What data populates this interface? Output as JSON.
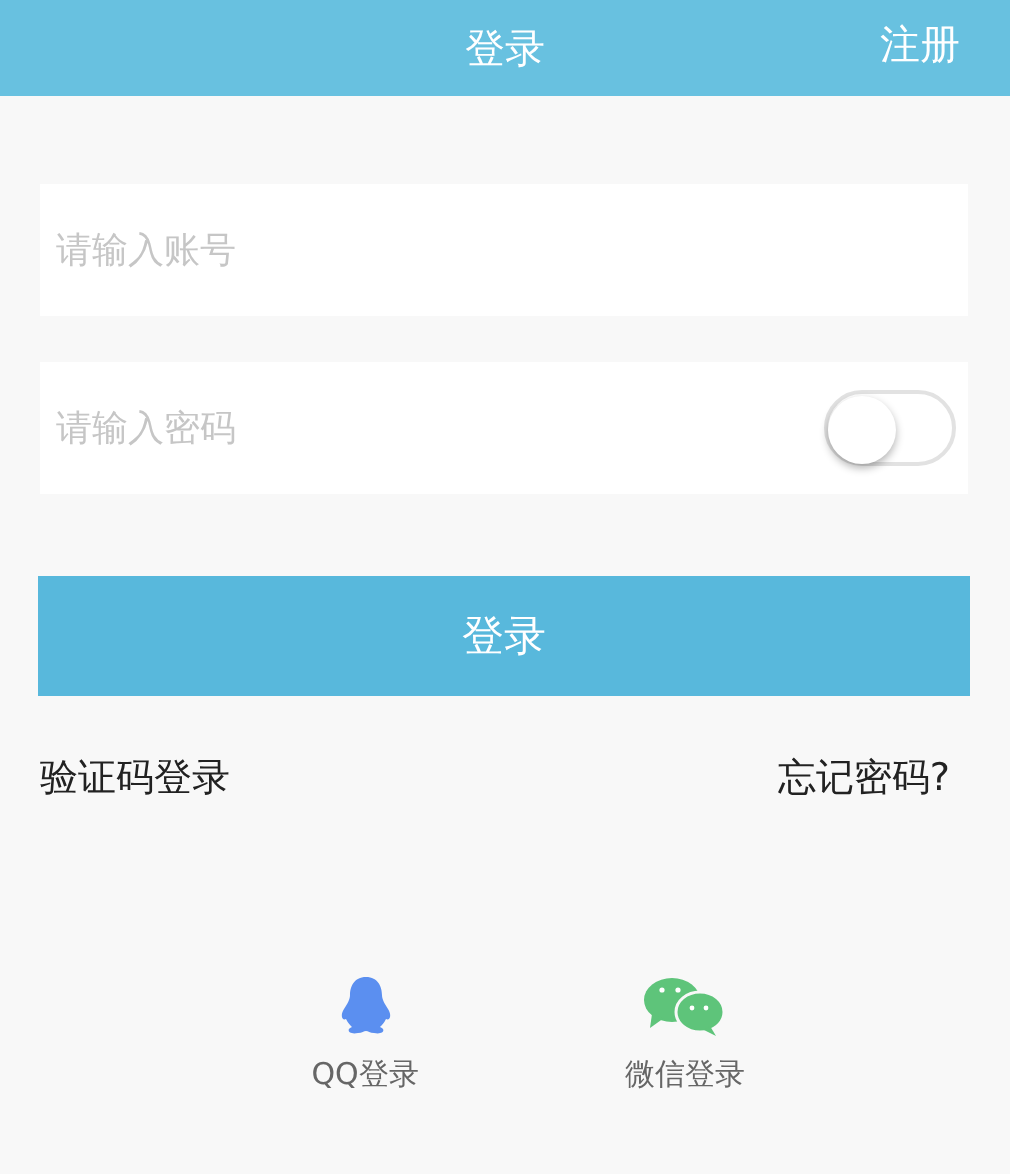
{
  "header": {
    "title": "登录",
    "action": "注册"
  },
  "account_field": {
    "placeholder": "请输入账号"
  },
  "password_field": {
    "placeholder": "请输入密码",
    "show_password": {
      "on": false
    }
  },
  "login_button": "登录",
  "links": {
    "sms_login": "验证码登录",
    "forgot_password": "忘记密码?"
  },
  "social_logins": [
    {
      "kind": "qq",
      "label": "QQ登录"
    },
    {
      "kind": "wechat",
      "label": "微信登录"
    }
  ]
}
